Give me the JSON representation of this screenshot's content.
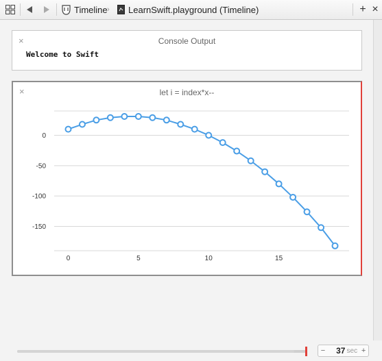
{
  "jumpbar": {
    "crumb_timeline": "Timeline",
    "crumb_chevron": "›",
    "crumb_file": "LearnSwift.playground (Timeline)",
    "back_glyph": "◀",
    "forward_glyph": "▶",
    "add_glyph": "+",
    "close_glyph": "×",
    "icons": [
      "grid-icon",
      "back-arrow-icon",
      "forward-arrow-icon",
      "timeline-icon",
      "playground-file-icon",
      "plus-icon",
      "close-icon"
    ]
  },
  "console": {
    "title": "Console Output",
    "close_glyph": "×",
    "text": "Welcome to Swift"
  },
  "chart": {
    "title": "let i = index*x--",
    "close_glyph": "×",
    "colors": {
      "line": "#4a9ee6",
      "point_fill": "#ffffff",
      "grid": "#d8d8d8",
      "focus_border": "#e0413a"
    }
  },
  "chart_data": {
    "type": "line",
    "title": "let i = index*x--",
    "xlabel": "",
    "ylabel": "",
    "x_ticks": [
      0,
      5,
      10,
      15
    ],
    "y_ticks": [
      0,
      -50,
      -100,
      -150
    ],
    "xlim": [
      -1,
      20
    ],
    "ylim": [
      -190,
      40
    ],
    "grid": true,
    "series": [
      {
        "x": [
          0,
          1,
          2,
          3,
          4,
          5,
          6,
          7,
          8,
          9,
          10,
          11,
          12,
          13,
          14,
          15,
          16,
          17,
          18,
          19
        ],
        "y": [
          10,
          18,
          25,
          29,
          31,
          31,
          29,
          25,
          18,
          10,
          0,
          -12,
          -26,
          -42,
          -60,
          -80,
          -102,
          -126,
          -152,
          -182
        ]
      }
    ]
  },
  "scrubber": {
    "progress": 0.96,
    "minus": "−",
    "value": "37",
    "unit": "sec",
    "plus": "+",
    "colors": {
      "marker": "#e0413a"
    }
  }
}
